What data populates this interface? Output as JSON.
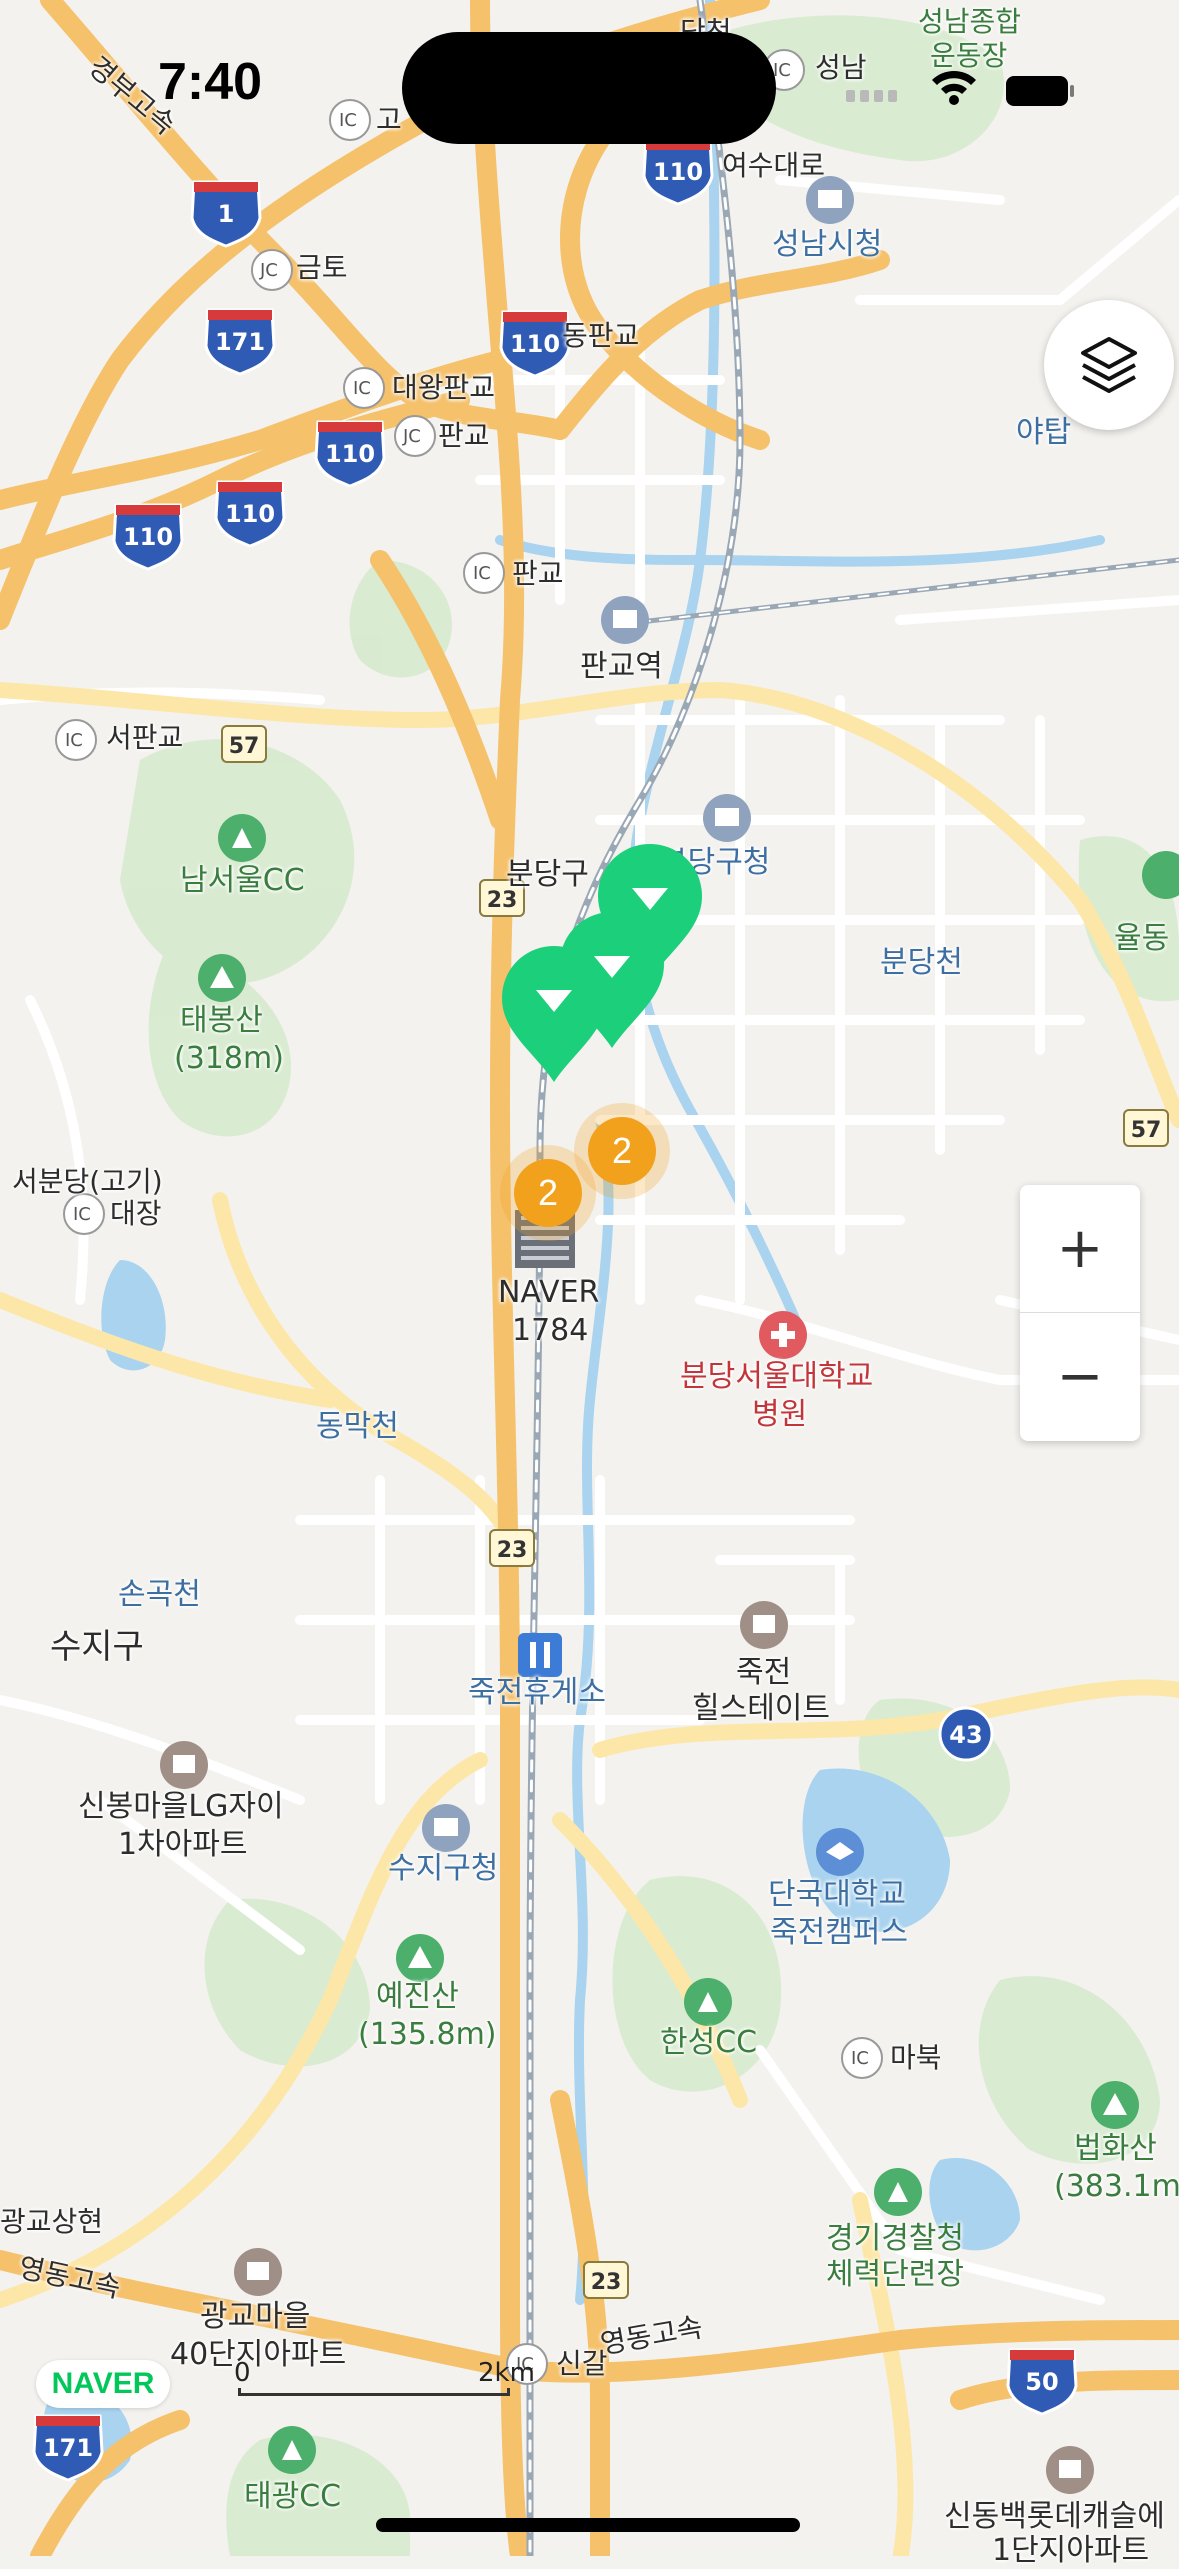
{
  "status_bar": {
    "time": "7:40"
  },
  "labels": {
    "top_road_danchi": "단천",
    "seongnam_ic": "성남",
    "seongnam_sports": "성남종합",
    "seongnam_sports2": "운동장",
    "gyeongbu": "경부고속",
    "gosa_ic": "고",
    "geumto": "금토",
    "yeosu": "여수대로",
    "seongnam_cityhall": "성남시청",
    "dongpangyo": "동판교",
    "daewang_pangyo": "대왕판교",
    "pangyo_jc": "판교",
    "pangyo_ic": "판교",
    "yatap": "야탑",
    "pangyo_station": "판교역",
    "seopangyo": "서판교",
    "road57": "57",
    "namseoul_cc": "남서울CC",
    "bundang_gu": "분당구",
    "bundang_gu_office": "분당구청",
    "bundangcheon": "분당천",
    "yuldong": "율동",
    "taebongsan": "태봉산",
    "taebongsan_h": "(318m)",
    "road23": "23",
    "road57b": "57",
    "seobundang": "서분당(고기)",
    "daejang": "대장",
    "naver": "NAVER",
    "naver_1784": "1784",
    "snubh": "분당서울대학교",
    "snubh2": "병원",
    "dongmakcheon": "동막천",
    "road23b": "23",
    "songokcheon": "손곡천",
    "suji_gu": "수지구",
    "jukjeon_rest": "죽전휴게소",
    "jukjeon": "죽전",
    "hillstate": "힐스테이트",
    "road43": "43",
    "sinbong_lg": "신봉마을LG자이",
    "sinbong_lg2": "1차아파트",
    "suji_office": "수지구청",
    "dankook": "단국대학교",
    "dankook2": "죽전캠퍼스",
    "yejinsan": "예진산",
    "yejinsan_h": "(135.8m)",
    "hansung_cc": "한성CC",
    "mabuk": "마북",
    "beophwasan": "법화산",
    "beophwasan_h": "(383.1m)",
    "gwanggyo_hs": "광교상현",
    "police": "경기경찰청",
    "police2": "체력단련장",
    "road23c": "23",
    "yeongdong": "영동고속",
    "gwanggyo_40": "광교마을",
    "gwanggyo_40b": "40단지아파트",
    "singal": "신갈",
    "yeongdong2": "영동고속",
    "road50": "50",
    "road171b": "171",
    "taegwang_cc": "태광CC",
    "sindong": "신동백롯데캐슬에",
    "sindong2": "1단지아파트",
    "road110a": "110",
    "road1": "1",
    "road171": "171",
    "road110b": "110",
    "road110c": "110",
    "road110d": "110",
    "road110e": "110"
  },
  "clusters": [
    {
      "count": "2"
    },
    {
      "count": "2"
    }
  ],
  "controls": {
    "zoom_in": "+",
    "zoom_out": "−"
  },
  "branding": {
    "logo": "NAVER"
  },
  "scale": {
    "start": "0",
    "end": "2km"
  },
  "colors": {
    "highway": "#f5c16b",
    "arterial": "#fde7a8",
    "road": "#ffffff",
    "water": "#a9d3ef",
    "park": "#cfe8c8",
    "pin": "#1ccf7a",
    "cluster": "#f2a11d"
  }
}
